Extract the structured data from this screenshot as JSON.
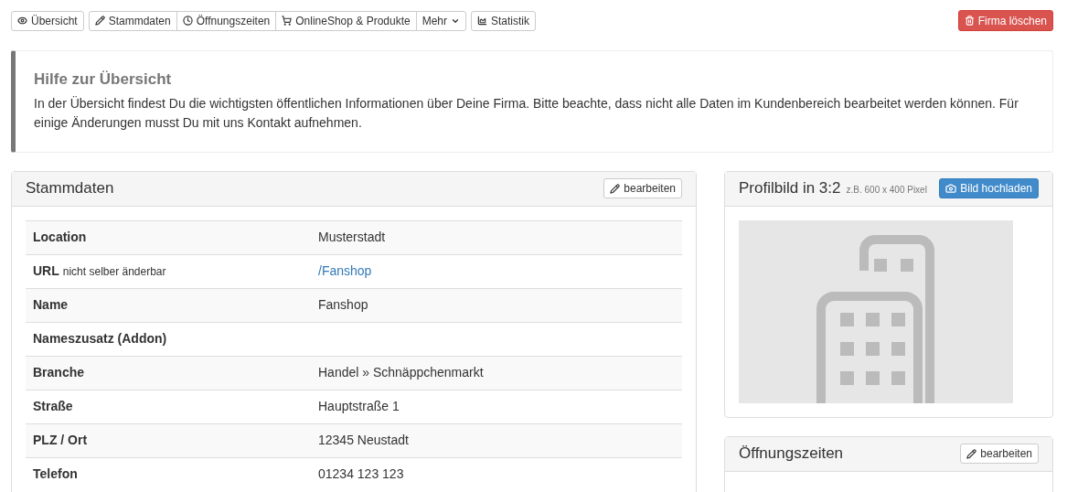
{
  "toolbar": {
    "groups": [
      [
        {
          "kind": "eye",
          "label": "Übersicht"
        }
      ],
      [
        {
          "kind": "pencil",
          "label": "Stammdaten"
        },
        {
          "kind": "clock",
          "label": "Öffnungszeiten"
        },
        {
          "kind": "cart",
          "label": "OnlineShop & Produkte"
        },
        {
          "kind": "dropdown",
          "label": "Mehr"
        }
      ],
      [
        {
          "kind": "chart",
          "label": "Statistik"
        }
      ]
    ],
    "danger_button": {
      "label": "Firma löschen"
    }
  },
  "help": {
    "title": "Hilfe zur Übersicht",
    "text": "In der Übersicht findest Du die wichtigsten öffentlichen Informationen über Deine Firma. Bitte beachte, dass nicht alle Daten im Kundenbereich bearbeitet werden können. Für einige Änderungen musst Du mit uns Kontakt aufnehmen."
  },
  "stammdaten": {
    "title": "Stammdaten",
    "edit_button": "bearbeiten",
    "rows": [
      {
        "label": "Location",
        "value": "Musterstadt",
        "kind": "text"
      },
      {
        "label": "URL",
        "note": "nicht selber änderbar",
        "value": "/Fanshop",
        "kind": "link"
      },
      {
        "label": "Name",
        "value": "Fanshop",
        "kind": "text"
      },
      {
        "label": "Nameszusatz (Addon)"
      },
      {
        "label": "Branche",
        "value": "Handel » Schnäppchenmarkt",
        "kind": "text"
      },
      {
        "label": "Straße",
        "value": "Hauptstraße 1",
        "kind": "text"
      },
      {
        "label": "PLZ / Ort",
        "value": "12345 Neustadt",
        "kind": "text"
      },
      {
        "label": "Telefon",
        "value": "01234 123 123",
        "kind": "text"
      }
    ]
  },
  "profilbild": {
    "title": "Profilbild in 3:2",
    "hint": "z.B. 600 x 400 Pixel",
    "upload_button": "Bild hochladen"
  },
  "oeffnungszeiten": {
    "title": "Öffnungszeiten",
    "edit_button": "bearbeiten"
  }
}
